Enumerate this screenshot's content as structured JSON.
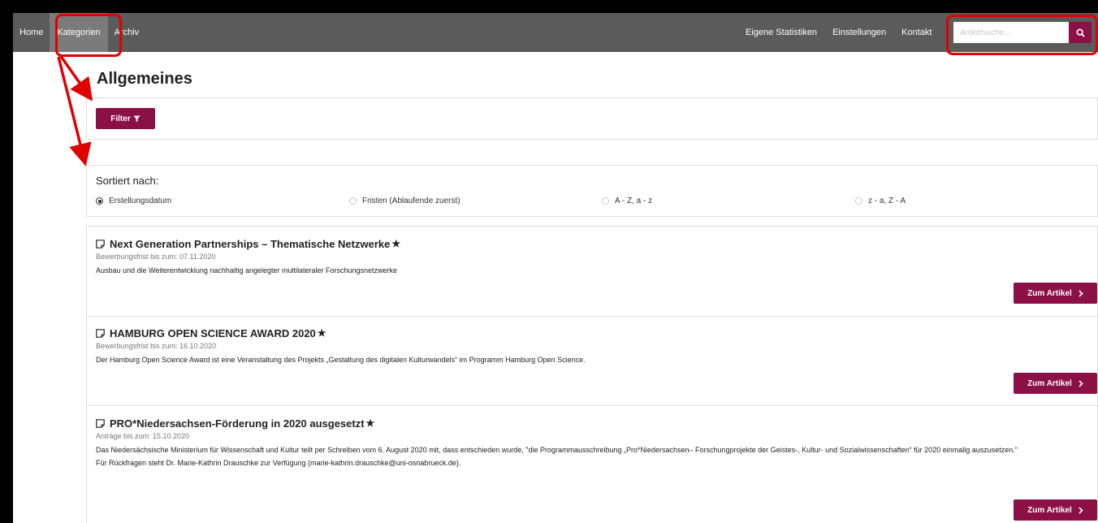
{
  "nav": {
    "left_items": [
      {
        "label": "Home",
        "active": false
      },
      {
        "label": "Kategorien",
        "active": true
      },
      {
        "label": "Archiv",
        "active": false
      }
    ],
    "right_items": [
      {
        "label": "Eigene Statistiken"
      },
      {
        "label": "Einstellungen"
      },
      {
        "label": "Kontakt"
      }
    ],
    "search_placeholder": "Artikelsuche...",
    "search_icon": "magnifier-icon"
  },
  "page": {
    "title": "Allgemeines",
    "filter_label": "Filter",
    "filter_icon": "funnel-icon"
  },
  "sort": {
    "title": "Sortiert nach:",
    "options": [
      {
        "label": "Erstellungsdatum",
        "checked": true
      },
      {
        "label": "Fristen (Ablaufende zuerst)",
        "checked": false
      },
      {
        "label": "A - Z, a - z",
        "checked": false
      },
      {
        "label": "z - a, Z - A",
        "checked": false
      }
    ]
  },
  "articles": [
    {
      "title": "Next Generation Partnerships – Thematische Netzwerke",
      "deadline": "Bewerbungsfrist bis zum: 07.11.2020",
      "description": "Ausbau und die Weiterentwicklung nachhaltig angelegter multilateraler Forschungsnetzwerke",
      "extra": "",
      "button_label": "Zum Artikel"
    },
    {
      "title": "HAMBURG OPEN SCIENCE AWARD 2020",
      "deadline": "Bewerbungsfrist bis zum: 16.10.2020",
      "description": "Der Hamburg Open Science Award ist eine Veranstaltung des Projekts „Gestaltung des digitalen Kulturwandels“ im Programm Hamburg Open Science.",
      "extra": "",
      "button_label": "Zum Artikel"
    },
    {
      "title": "PRO*Niedersachsen-Förderung in 2020 ausgesetzt",
      "deadline": "Anträge bis zum: 15.10.2020",
      "description": "Das Niedersächsische Ministerium für Wissenschaft und Kultur teilt per Schreiben vom 6. August 2020 mit, dass entschieden wurde, \"die Programmausschreibung „Pro*Niedersachsen– Forschungprojekte der Geistes-, Kultur- und Sozialwissenschaften“ für 2020 einmalig auszusetzen.\"",
      "extra": "Für Rückfragen steht Dr. Marie-Kathrin Drauschke zur Verfügung (marie-kathrin.drauschke@uni-osnabrueck.de).",
      "button_label": "Zum Artikel"
    }
  ],
  "colors": {
    "navbar": "#5b5b5b",
    "navbar_active": "#7b7b7b",
    "accent": "#8b1045",
    "annotation": "#e00000"
  }
}
